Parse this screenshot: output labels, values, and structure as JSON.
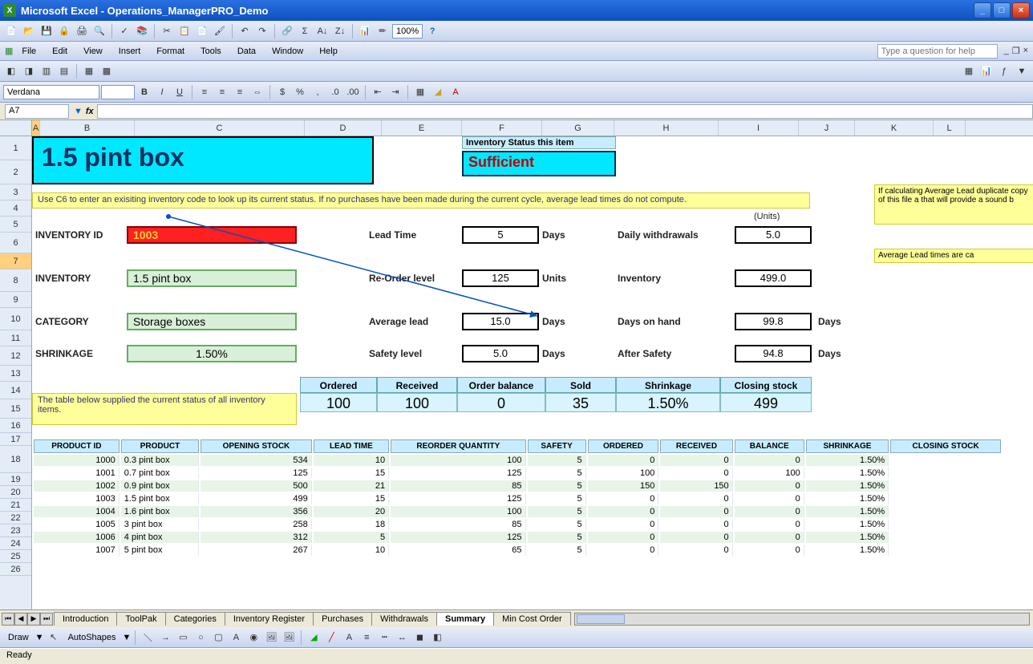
{
  "window": {
    "app": "Microsoft Excel",
    "doc": "Operations_ManagerPRO_Demo"
  },
  "menus": [
    "File",
    "Edit",
    "View",
    "Insert",
    "Format",
    "Tools",
    "Data",
    "Window",
    "Help"
  ],
  "help_placeholder": "Type a question for help",
  "font_name": "Verdana",
  "zoom": "100%",
  "name_box": "A7",
  "col_headers": [
    "A",
    "B",
    "C",
    "D",
    "E",
    "F",
    "G",
    "H",
    "I",
    "J",
    "K",
    "L"
  ],
  "row_headers": [
    1,
    2,
    3,
    4,
    5,
    6,
    7,
    8,
    9,
    10,
    11,
    12,
    13,
    14,
    15,
    16,
    17,
    18,
    19,
    20,
    21,
    22,
    23,
    24,
    25,
    26
  ],
  "main": {
    "title": "1.5 pint box",
    "status_label": "Inventory Status this item",
    "status_value": "Sufficient",
    "note": "Use C6 to enter an exisiting inventory code to look up its current status. If no purchases have been made during the current cycle, average lead times do not compute.",
    "side_note": "If calculating Average Lead duplicate copy of this file a that will provide a sound b",
    "side_note2": "Average Lead times are ca",
    "units_label": "(Units)",
    "fields": {
      "inventory_id": {
        "label": "INVENTORY ID",
        "value": "1003"
      },
      "inventory": {
        "label": "INVENTORY",
        "value": "1.5 pint box"
      },
      "category": {
        "label": "CATEGORY",
        "value": "Storage boxes"
      },
      "shrinkage": {
        "label": "SHRINKAGE",
        "value": "1.50%"
      },
      "lead_time": {
        "label": "Lead Time",
        "value": "5",
        "unit": "Days"
      },
      "reorder": {
        "label": "Re-Order level",
        "value": "125",
        "unit": "Units"
      },
      "avg_lead": {
        "label": "Average lead",
        "value": "15.0",
        "unit": "Days"
      },
      "safety": {
        "label": "Safety level",
        "value": "5.0",
        "unit": "Days"
      },
      "daily_withdrawals": {
        "label": "Daily withdrawals",
        "value": "5.0"
      },
      "inventory_qty": {
        "label": "Inventory",
        "value": "499.0"
      },
      "days_on_hand": {
        "label": "Days on hand",
        "value": "99.8",
        "unit": "Days"
      },
      "after_safety": {
        "label": "After Safety",
        "value": "94.8",
        "unit": "Days"
      }
    },
    "summary_headers": [
      "Ordered",
      "Received",
      "Order balance",
      "Sold",
      "Shrinkage",
      "Closing stock"
    ],
    "summary_values": [
      "100",
      "100",
      "0",
      "35",
      "1.50%",
      "499"
    ],
    "table_note": "The table below supplied the current status of all inventory items."
  },
  "product_table": {
    "headers": [
      "PRODUCT ID",
      "PRODUCT",
      "OPENING STOCK",
      "LEAD TIME",
      "REORDER QUANTITY",
      "SAFETY",
      "ORDERED",
      "RECEIVED",
      "BALANCE",
      "SHRINKAGE",
      "CLOSING STOCK"
    ],
    "rows": [
      [
        "1000",
        "0.3 pint box",
        "534",
        "10",
        "100",
        "5",
        "0",
        "0",
        "0",
        "1.50%"
      ],
      [
        "1001",
        "0.7 pint box",
        "125",
        "15",
        "125",
        "5",
        "100",
        "0",
        "100",
        "1.50%"
      ],
      [
        "1002",
        "0.9 pint box",
        "500",
        "21",
        "85",
        "5",
        "150",
        "150",
        "0",
        "1.50%"
      ],
      [
        "1003",
        "1.5 pint box",
        "499",
        "15",
        "125",
        "5",
        "0",
        "0",
        "0",
        "1.50%"
      ],
      [
        "1004",
        "1.6 pint box",
        "356",
        "20",
        "100",
        "5",
        "0",
        "0",
        "0",
        "1.50%"
      ],
      [
        "1005",
        "3 pint box",
        "258",
        "18",
        "85",
        "5",
        "0",
        "0",
        "0",
        "1.50%"
      ],
      [
        "1006",
        "4 pint box",
        "312",
        "5",
        "125",
        "5",
        "0",
        "0",
        "0",
        "1.50%"
      ],
      [
        "1007",
        "5 pint box",
        "267",
        "10",
        "65",
        "5",
        "0",
        "0",
        "0",
        "1.50%"
      ]
    ]
  },
  "sheet_tabs": [
    "Introduction",
    "ToolPak",
    "Categories",
    "Inventory Register",
    "Purchases",
    "Withdrawals",
    "Summary",
    "Min Cost Order"
  ],
  "active_tab": "Summary",
  "draw_toolbar": {
    "draw": "Draw",
    "autoshapes": "AutoShapes"
  },
  "status": "Ready"
}
